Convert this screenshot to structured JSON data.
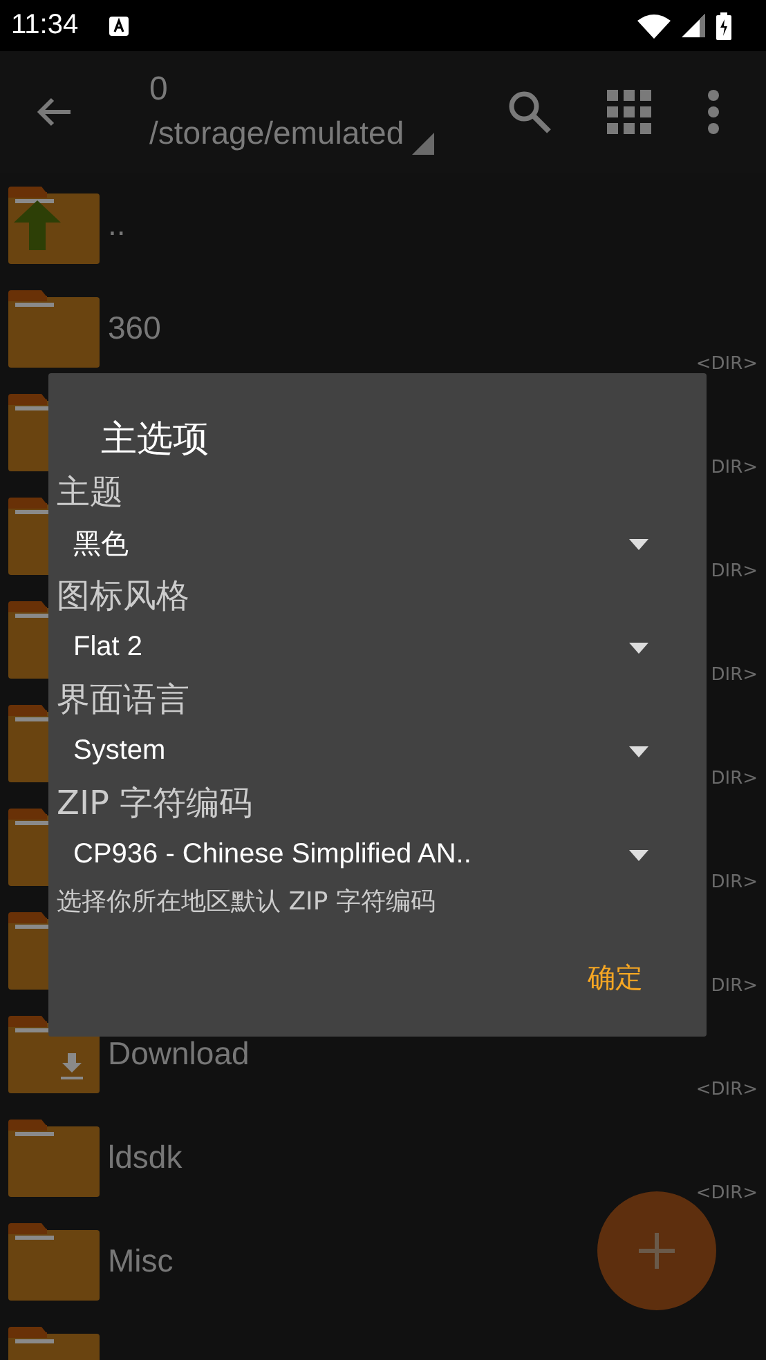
{
  "status_bar": {
    "time": "11:34"
  },
  "toolbar": {
    "title": "0",
    "path": "/storage/emulated"
  },
  "files": [
    {
      "kind": "up",
      "name": ".."
    },
    {
      "kind": "folder",
      "name": "360",
      "size": "<DIR>"
    },
    {
      "kind": "folder",
      "size": "DIR>"
    },
    {
      "kind": "folder",
      "size": "DIR>"
    },
    {
      "kind": "folder",
      "size": "DIR>"
    },
    {
      "kind": "folder",
      "size": "DIR>"
    },
    {
      "kind": "folder",
      "size": "DIR>"
    },
    {
      "kind": "folder",
      "size": "DIR>"
    },
    {
      "kind": "download",
      "name": "Download",
      "size": "<DIR>"
    },
    {
      "kind": "folder",
      "name": "ldsdk",
      "size": "<DIR>"
    },
    {
      "kind": "folder",
      "name": "Misc"
    },
    {
      "kind": "folder"
    }
  ],
  "dialog": {
    "title": "主选项",
    "settings": [
      {
        "label": "主题",
        "value": "黑色"
      },
      {
        "label": "图标风格",
        "value": "Flat 2"
      },
      {
        "label": "界面语言",
        "value": "System"
      },
      {
        "label": "ZIP 字符编码",
        "value": "CP936 - Chinese Simplified AN.."
      }
    ],
    "hint": "选择你所在地区默认 ZIP 字符编码",
    "button": "确定"
  }
}
